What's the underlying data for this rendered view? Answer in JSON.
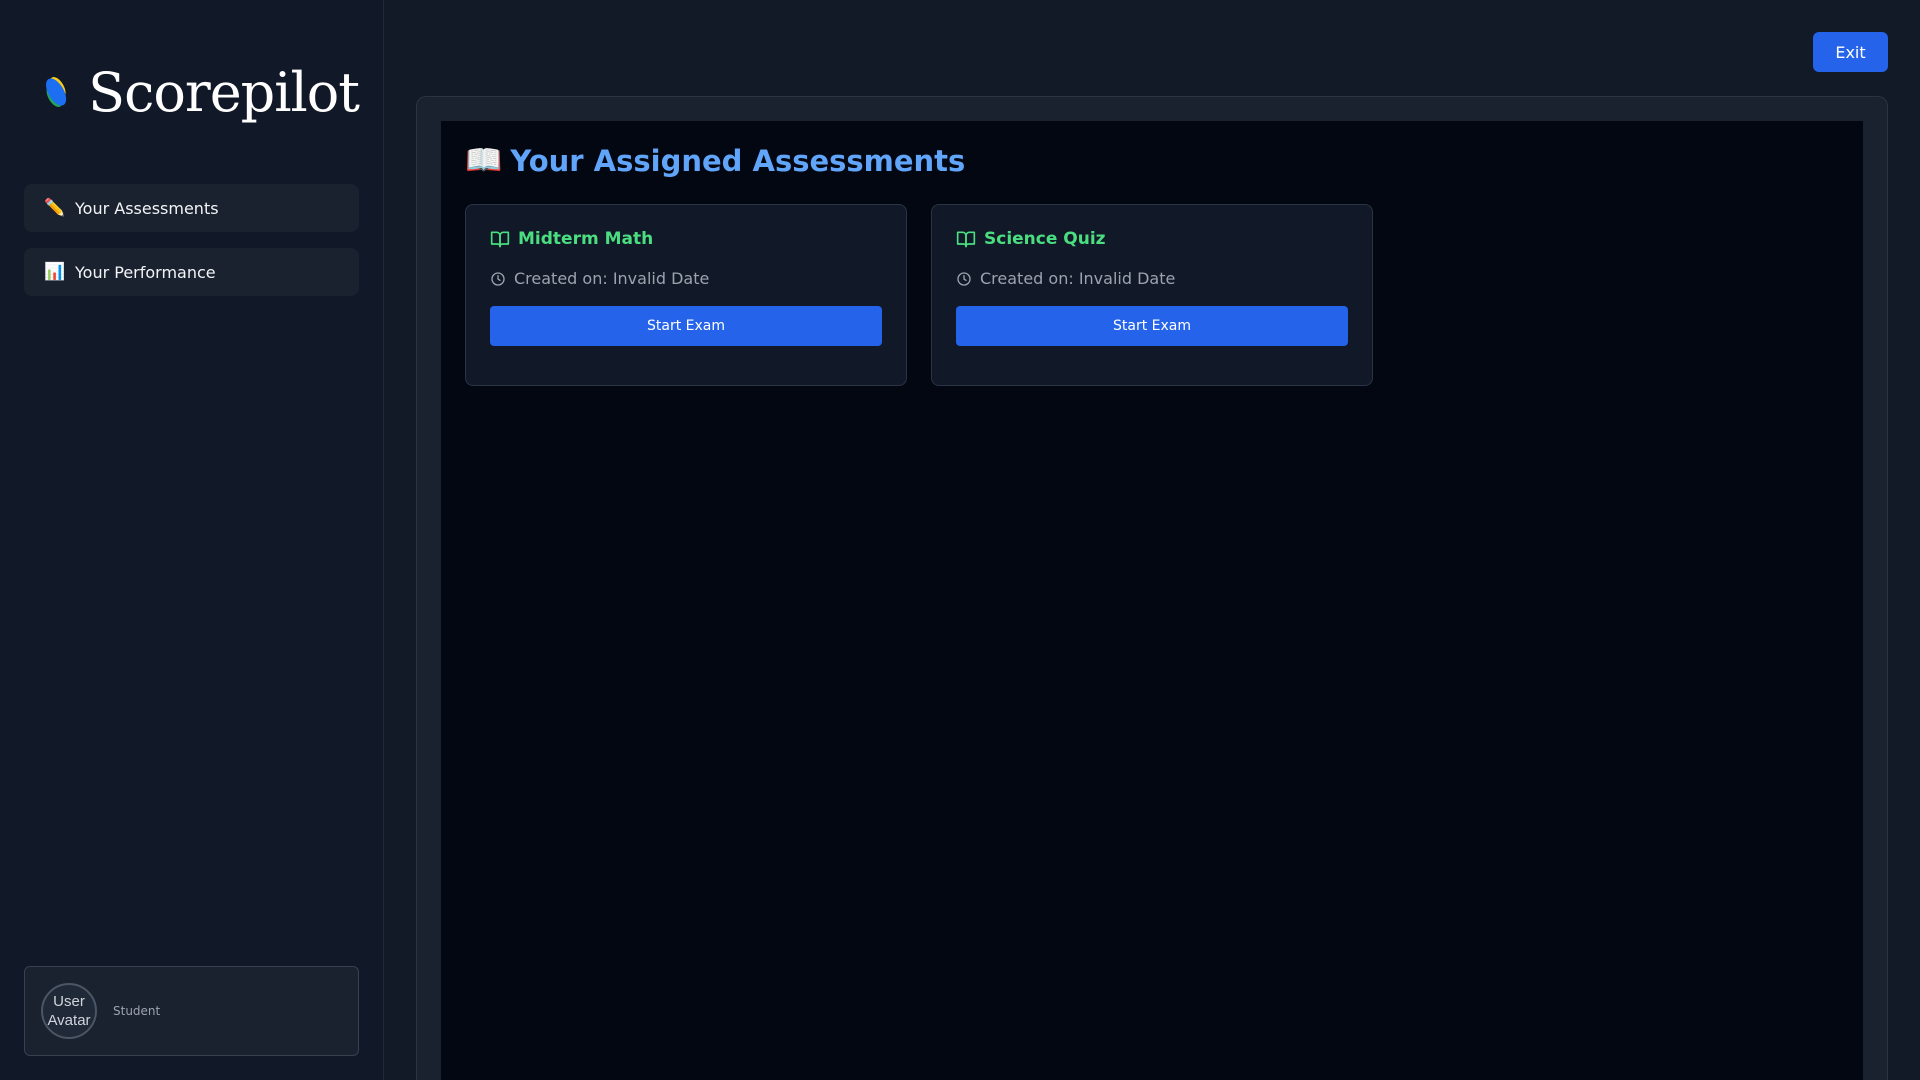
{
  "brand": {
    "name": "Scorepilot"
  },
  "sidebar": {
    "items": [
      {
        "icon": "✏️",
        "label": "Your Assessments"
      },
      {
        "icon": "📊",
        "label": "Your Performance"
      }
    ]
  },
  "user": {
    "avatar_alt_line1": "User",
    "avatar_alt_line2": "Avatar",
    "role": "Student"
  },
  "header": {
    "exit_label": "Exit"
  },
  "main": {
    "title_icon": "📖",
    "title": "Your Assigned Assessments",
    "cards": [
      {
        "title": "Midterm Math",
        "date": "Created on: Invalid Date",
        "button": "Start Exam"
      },
      {
        "title": "Science Quiz",
        "date": "Created on: Invalid Date",
        "button": "Start Exam"
      }
    ]
  },
  "colors": {
    "accent": "#2563eb",
    "title": "#60a5fa",
    "card_title": "#4ade80",
    "logo_blue": "#1d6ff2",
    "logo_yellow": "#facc15",
    "logo_green": "#22a35a"
  }
}
